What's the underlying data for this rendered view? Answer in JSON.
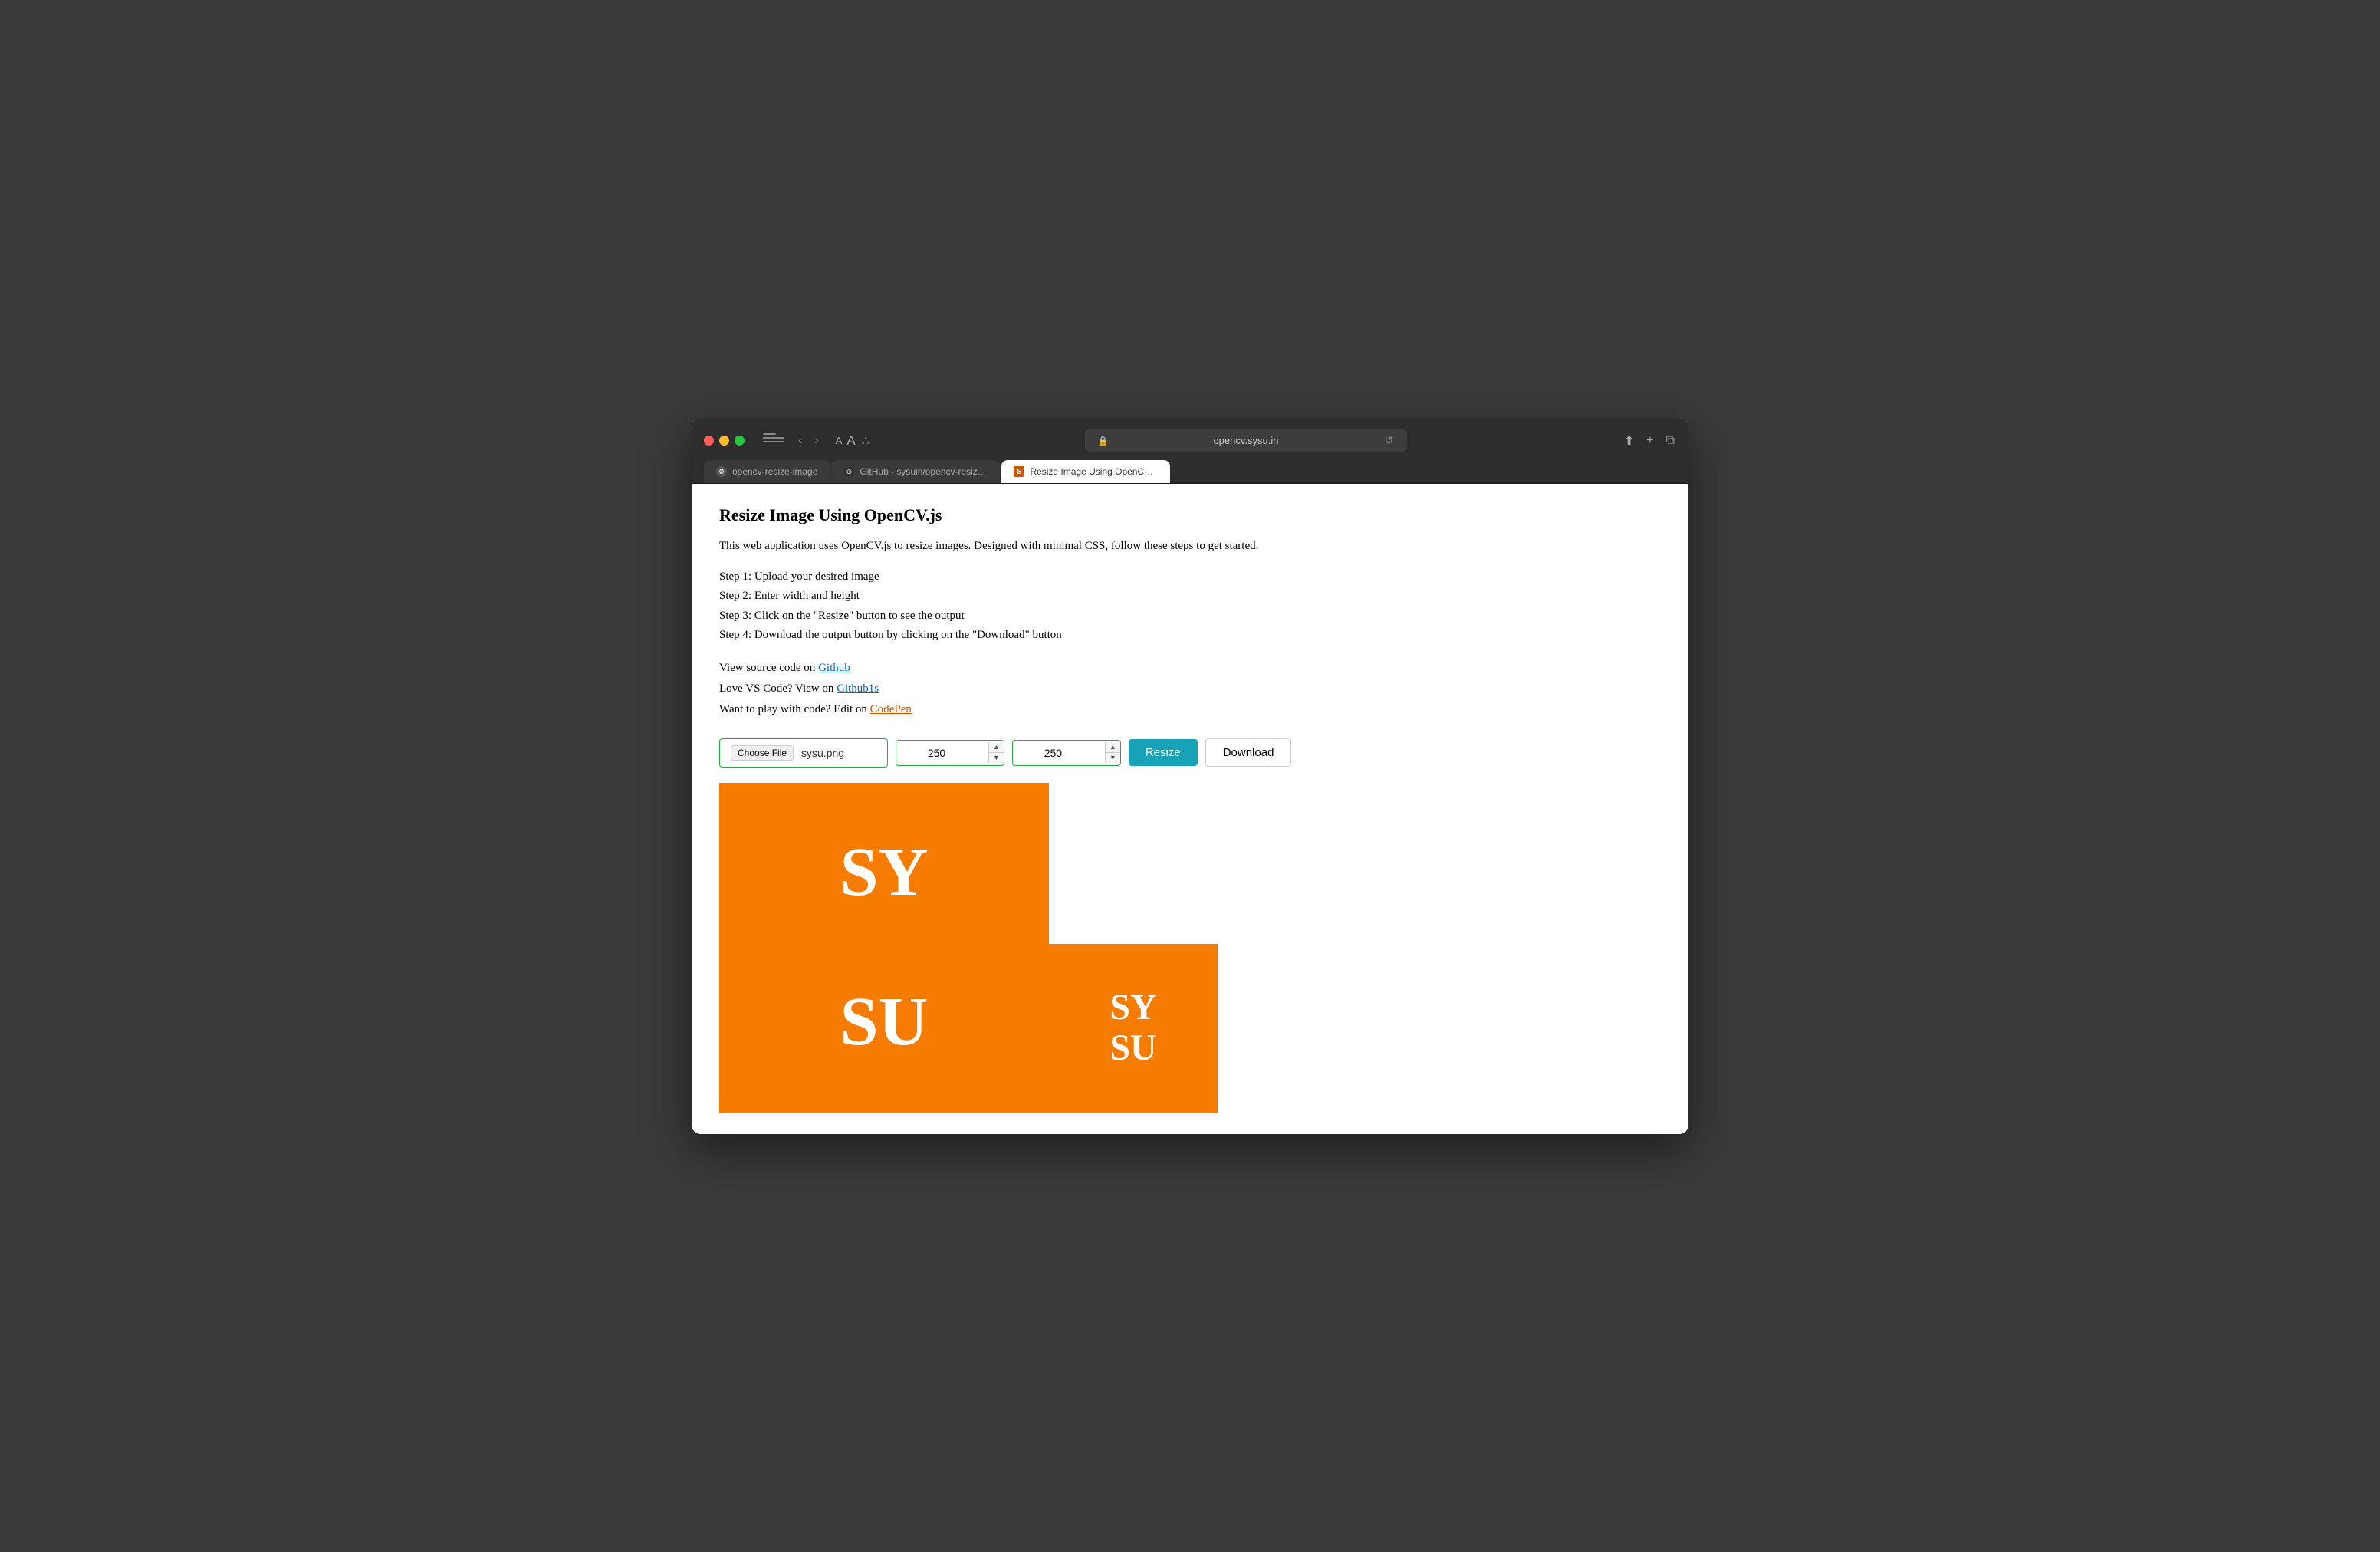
{
  "browser": {
    "address": "opencv.sysu.in",
    "reload_label": "↺",
    "back_label": "‹",
    "forward_label": "›",
    "font_a_small": "A",
    "font_a_large": "A",
    "shield_label": "⊕",
    "share_label": "⬆",
    "new_tab_label": "+",
    "windows_label": "⧉"
  },
  "tabs": [
    {
      "id": "tab1",
      "label": "opencv-resize-image",
      "active": false,
      "icon": "opencv"
    },
    {
      "id": "tab2",
      "label": "GitHub - sysuin/opencv-resize-image: Resize Image Using OpenCV.js",
      "active": false,
      "icon": "github"
    },
    {
      "id": "tab3",
      "label": "Resize Image Using OpenCV.js",
      "active": true,
      "icon": "s"
    }
  ],
  "page": {
    "title": "Resize Image Using OpenCV.js",
    "description": "This web application uses OpenCV.js to resize images. Designed with minimal CSS, follow these steps to get started.",
    "steps": [
      "Step 1: Upload your desired image",
      "Step 2: Enter width and height",
      "Step 3: Click on the \"Resize\" button to see the output",
      "Step 4: Download the output button by clicking on the \"Download\" button"
    ],
    "links": [
      {
        "prefix": "View source code on ",
        "text": "Github",
        "class": "normal"
      },
      {
        "prefix": "Love VS Code? View on ",
        "text": "Github1s",
        "class": "normal"
      },
      {
        "prefix": "Want to play with code? Edit on ",
        "text": "CodePen",
        "class": "codepen"
      }
    ]
  },
  "controls": {
    "choose_file_label": "Choose File",
    "file_name": "sysu.png",
    "width_value": "250",
    "height_value": "250",
    "resize_label": "Resize",
    "download_label": "Download"
  },
  "original_image": {
    "line1": "SY",
    "line2": "SU"
  },
  "resized_image": {
    "line1": "SY",
    "line2": "SU"
  }
}
